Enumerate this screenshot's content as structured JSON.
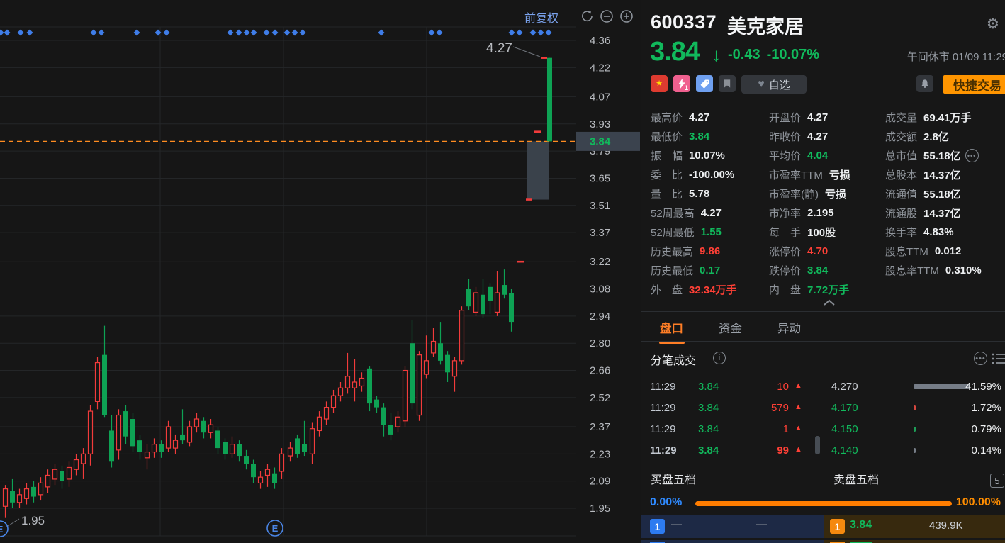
{
  "chart": {
    "adjust_label": "前复权",
    "price_badge": "3.84",
    "high_annotation": "4.27",
    "low_annotation": "1.95",
    "event_icon_label": "E",
    "colors": {
      "up": "#f23b3b",
      "down": "#0ea254",
      "dashed_line": "#ff8c21",
      "diamond": "#3f7de8",
      "grid": "#242628",
      "axis_text": "#b7babf",
      "badge_bg": "#3b434e",
      "gap_box": "#3a424b"
    }
  },
  "chart_data": {
    "type": "candlestick",
    "symbol": "600337",
    "y_ticks": [
      4.36,
      4.22,
      4.07,
      3.93,
      3.79,
      3.65,
      3.51,
      3.37,
      3.22,
      3.08,
      2.94,
      2.8,
      2.66,
      2.52,
      2.37,
      2.23,
      2.09,
      1.95
    ],
    "y_range": [
      1.95,
      4.36
    ],
    "current_price": 3.84,
    "prev_close": 4.27,
    "grid_x": [
      226,
      400,
      602
    ],
    "event_marker_xs": [
      1,
      10,
      29,
      42,
      132,
      143,
      193,
      223,
      235,
      325,
      337,
      348,
      358,
      376,
      388,
      405,
      416,
      427,
      538,
      609,
      620,
      722,
      733,
      752,
      763,
      774
    ],
    "gap_box": {
      "x": 744,
      "w": 30,
      "v_top": 3.84,
      "v_bottom": 3.54
    },
    "candles": [
      [
        4,
        1.96,
        2.07,
        1.9,
        2.05
      ],
      [
        14,
        2.04,
        2.1,
        1.95,
        1.98
      ],
      [
        24,
        1.98,
        2.05,
        1.95,
        2.02
      ],
      [
        34,
        2.0,
        2.08,
        1.97,
        2.05
      ],
      [
        44,
        2.06,
        2.09,
        1.98,
        2.01
      ],
      [
        54,
        2.02,
        2.11,
        1.99,
        2.08
      ],
      [
        64,
        2.06,
        2.15,
        2.03,
        2.12
      ],
      [
        74,
        2.1,
        2.18,
        2.07,
        2.15
      ],
      [
        84,
        2.14,
        2.17,
        2.05,
        2.09
      ],
      [
        94,
        2.1,
        2.19,
        2.06,
        2.16
      ],
      [
        104,
        2.15,
        2.23,
        2.12,
        2.2
      ],
      [
        114,
        2.18,
        2.26,
        2.1,
        2.23
      ],
      [
        124,
        2.23,
        2.48,
        2.17,
        2.45
      ],
      [
        134,
        2.5,
        2.73,
        2.46,
        2.7
      ],
      [
        144,
        2.74,
        2.89,
        2.42,
        2.43
      ],
      [
        154,
        2.35,
        2.43,
        2.16,
        2.19
      ],
      [
        164,
        2.25,
        2.46,
        2.2,
        2.43
      ],
      [
        174,
        2.45,
        2.48,
        2.28,
        2.32
      ],
      [
        184,
        2.41,
        2.44,
        2.24,
        2.27
      ],
      [
        194,
        2.3,
        2.33,
        2.2,
        2.24
      ],
      [
        204,
        2.21,
        2.28,
        2.15,
        2.24
      ],
      [
        214,
        2.24,
        2.31,
        2.21,
        2.28
      ],
      [
        224,
        2.28,
        2.3,
        2.21,
        2.24
      ],
      [
        234,
        2.26,
        2.4,
        2.24,
        2.37
      ],
      [
        244,
        2.26,
        2.33,
        2.23,
        2.3
      ],
      [
        254,
        2.33,
        2.46,
        2.28,
        2.3
      ],
      [
        264,
        2.29,
        2.4,
        2.27,
        2.37
      ],
      [
        274,
        2.37,
        2.44,
        2.34,
        2.41
      ],
      [
        284,
        2.4,
        2.42,
        2.31,
        2.34
      ],
      [
        294,
        2.34,
        2.41,
        2.31,
        2.38
      ],
      [
        304,
        2.35,
        2.37,
        2.23,
        2.26
      ],
      [
        314,
        2.29,
        2.31,
        2.2,
        2.23
      ],
      [
        324,
        2.23,
        2.32,
        2.21,
        2.28
      ],
      [
        334,
        2.28,
        2.3,
        2.19,
        2.22
      ],
      [
        344,
        2.22,
        2.25,
        2.15,
        2.18
      ],
      [
        354,
        2.18,
        2.2,
        2.08,
        2.11
      ],
      [
        364,
        2.08,
        2.14,
        2.05,
        2.11
      ],
      [
        374,
        2.12,
        2.18,
        2.06,
        2.15
      ],
      [
        384,
        2.13,
        2.16,
        2.05,
        2.08
      ],
      [
        394,
        2.14,
        2.26,
        2.1,
        2.23
      ],
      [
        406,
        2.22,
        2.29,
        2.19,
        2.26
      ],
      [
        416,
        2.31,
        2.33,
        2.21,
        2.23
      ],
      [
        426,
        2.28,
        2.4,
        2.22,
        2.24
      ],
      [
        437,
        2.23,
        2.39,
        2.18,
        2.36
      ],
      [
        447,
        2.35,
        2.45,
        2.32,
        2.42
      ],
      [
        457,
        2.41,
        2.5,
        2.38,
        2.47
      ],
      [
        467,
        2.47,
        2.56,
        2.44,
        2.53
      ],
      [
        477,
        2.53,
        2.6,
        2.5,
        2.57
      ],
      [
        487,
        2.57,
        2.75,
        2.54,
        2.63
      ],
      [
        497,
        2.57,
        2.72,
        2.5,
        2.6
      ],
      [
        507,
        2.58,
        2.65,
        2.55,
        2.62
      ],
      [
        518,
        2.67,
        2.68,
        2.45,
        2.49
      ],
      [
        528,
        2.51,
        2.53,
        2.44,
        2.47
      ],
      [
        538,
        2.47,
        2.49,
        2.32,
        2.38
      ],
      [
        548,
        2.38,
        2.44,
        2.3,
        2.33
      ],
      [
        558,
        2.37,
        2.45,
        2.34,
        2.42
      ],
      [
        568,
        2.4,
        2.68,
        2.37,
        2.66
      ],
      [
        578,
        2.8,
        2.92,
        2.46,
        2.49
      ],
      [
        588,
        2.43,
        2.76,
        2.4,
        2.74
      ],
      [
        598,
        2.64,
        2.84,
        2.62,
        2.71
      ],
      [
        608,
        2.75,
        2.88,
        2.73,
        2.81
      ],
      [
        618,
        2.8,
        2.91,
        2.69,
        2.71
      ],
      [
        628,
        2.74,
        2.76,
        2.6,
        2.65
      ],
      [
        638,
        2.63,
        2.73,
        2.55,
        2.71
      ],
      [
        648,
        2.71,
        2.99,
        2.69,
        2.97
      ],
      [
        658,
        3.08,
        3.13,
        2.97,
        2.99
      ],
      [
        668,
        2.96,
        3.09,
        2.94,
        3.06
      ],
      [
        678,
        3.05,
        3.13,
        2.93,
        2.95
      ],
      [
        688,
        3.09,
        3.11,
        2.95,
        3.02
      ],
      [
        698,
        2.96,
        3.17,
        2.94,
        3.06
      ],
      [
        708,
        3.1,
        3.18,
        3.03,
        3.05
      ],
      [
        718,
        3.06,
        3.08,
        2.86,
        2.91
      ],
      [
        731,
        3.22,
        3.22,
        3.22,
        3.22
      ],
      [
        743,
        3.54,
        3.54,
        3.54,
        3.54
      ],
      [
        755,
        3.89,
        3.89,
        3.89,
        3.89
      ],
      [
        764,
        4.27,
        4.27,
        4.27,
        4.27
      ],
      [
        772,
        4.27,
        4.27,
        3.84,
        3.84
      ]
    ]
  },
  "header": {
    "code": "600337",
    "name": "美克家居",
    "price": "3.84",
    "change": "-0.43",
    "change_pct": "-10.07%",
    "status_text": "午间休市 01/09 11:29",
    "lightning_badge": "1",
    "watchlist_label": "自选",
    "trade_button_label": "快捷交易"
  },
  "quote_grid": {
    "columns": [
      {
        "rows": [
          {
            "label": "最高价",
            "value": "4.27",
            "color": "white"
          },
          {
            "label": "最低价",
            "value": "3.84",
            "color": "green"
          },
          {
            "label": "振　幅",
            "value": "10.07%",
            "color": "white"
          },
          {
            "label": "委　比",
            "value": "-100.00%",
            "color": "white"
          },
          {
            "label": "量　比",
            "value": "5.78",
            "color": "white"
          },
          {
            "label": "52周最高",
            "value": "4.27",
            "color": "white"
          },
          {
            "label": "52周最低",
            "value": "1.55",
            "color": "green"
          },
          {
            "label": "历史最高",
            "value": "9.86",
            "color": "red"
          },
          {
            "label": "历史最低",
            "value": "0.17",
            "color": "green"
          },
          {
            "label": "外　盘",
            "value": "32.34万手",
            "color": "red"
          }
        ]
      },
      {
        "rows": [
          {
            "label": "开盘价",
            "value": "4.27",
            "color": "white"
          },
          {
            "label": "昨收价",
            "value": "4.27",
            "color": "white"
          },
          {
            "label": "平均价",
            "value": "4.04",
            "color": "green"
          },
          {
            "label": "市盈率TTM",
            "value": "亏损",
            "color": "white"
          },
          {
            "label": "市盈率(静)",
            "value": "亏损",
            "color": "white"
          },
          {
            "label": "市净率",
            "value": "2.195",
            "color": "white"
          },
          {
            "label": "每　手",
            "value": "100股",
            "color": "white"
          },
          {
            "label": "涨停价",
            "value": "4.70",
            "color": "red"
          },
          {
            "label": "跌停价",
            "value": "3.84",
            "color": "green"
          },
          {
            "label": "内　盘",
            "value": "7.72万手",
            "color": "green"
          }
        ]
      },
      {
        "rows": [
          {
            "label": "成交量",
            "value": "69.41万手",
            "color": "white"
          },
          {
            "label": "成交额",
            "value": "2.8亿",
            "color": "white"
          },
          {
            "label": "总市值",
            "value": "55.18亿",
            "color": "white",
            "more": true
          },
          {
            "label": "总股本",
            "value": "14.37亿",
            "color": "white"
          },
          {
            "label": "流通值",
            "value": "55.18亿",
            "color": "white"
          },
          {
            "label": "流通股",
            "value": "14.37亿",
            "color": "white"
          },
          {
            "label": "换手率",
            "value": "4.83%",
            "color": "white"
          },
          {
            "label": "股息TTM",
            "value": "0.012",
            "color": "white"
          },
          {
            "label": "股息率TTM",
            "value": "0.310%",
            "color": "white"
          }
        ]
      }
    ]
  },
  "tabs": [
    {
      "label": "盘口",
      "active": true
    },
    {
      "label": "资金",
      "active": false
    },
    {
      "label": "异动",
      "active": false
    }
  ],
  "tick_trades": {
    "title": "分笔成交",
    "rows": [
      {
        "time": "11:29",
        "price": "3.84",
        "count": "10"
      },
      {
        "time": "11:29",
        "price": "3.84",
        "count": "579"
      },
      {
        "time": "11:29",
        "price": "3.84",
        "count": "1"
      },
      {
        "time": "11:29",
        "price": "3.84",
        "count": "99"
      }
    ],
    "distribution": [
      {
        "price": "4.270",
        "pct": "41.59%",
        "pct_value": 41.59,
        "price_color": "flat",
        "bar_color": "#767d87"
      },
      {
        "price": "4.170",
        "pct": "1.72%",
        "pct_value": 1.72,
        "price_color": "down",
        "bar_color": "#d6473f"
      },
      {
        "price": "4.150",
        "pct": "0.79%",
        "pct_value": 0.79,
        "price_color": "down",
        "bar_color": "#1d9e57"
      },
      {
        "price": "4.140",
        "pct": "0.14%",
        "pct_value": 0.14,
        "price_color": "down",
        "bar_color": "#767d87"
      }
    ]
  },
  "five_levels": {
    "buy_title": "买盘五档",
    "sell_title": "卖盘五档",
    "depth_badge": "5",
    "buy_ratio": "0.00%",
    "sell_ratio": "100.00%",
    "row1": {
      "buy_level": "1",
      "buy_price": "—",
      "buy_volume": "—",
      "sell_level": "1",
      "sell_price": "3.84",
      "sell_volume": "439.9K"
    }
  }
}
